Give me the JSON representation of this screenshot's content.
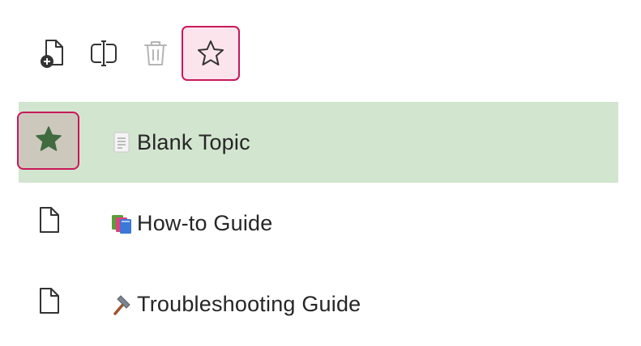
{
  "toolbar": {
    "buttons": [
      {
        "icon": "new-topic-icon",
        "tooltip": ""
      },
      {
        "icon": "rename-cursor-icon",
        "tooltip": ""
      },
      {
        "icon": "trash-icon",
        "tooltip": ""
      },
      {
        "icon": "star-outline-icon",
        "tooltip": ""
      }
    ]
  },
  "topics": [
    {
      "label": "Blank Topic",
      "emoji": "page-icon",
      "favorite": true,
      "selected": true
    },
    {
      "label": "How-to Guide",
      "emoji": "books-icon",
      "favorite": false,
      "selected": false
    },
    {
      "label": "Troubleshooting Guide",
      "emoji": "hammer-icon",
      "favorite": false,
      "selected": false
    }
  ],
  "colors": {
    "active_row": "#d2e5cf",
    "accent_border": "#c8195a",
    "star_fill": "#3f6b3f",
    "selected_button_bg": "#fbe4ec"
  }
}
